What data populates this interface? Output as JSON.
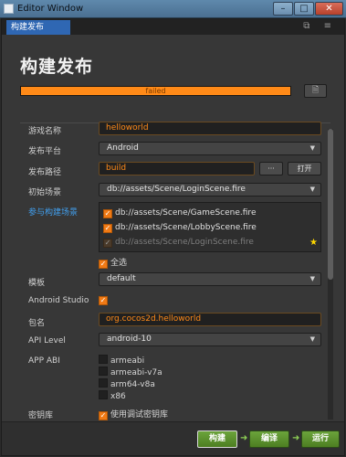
{
  "window": {
    "title": "Editor Window",
    "minimize": "–",
    "maximize": "□",
    "close": "✕"
  },
  "tab": {
    "label": "构建发布",
    "icons": "⧉ ≡"
  },
  "heading": "构建发布",
  "progress": {
    "status_text": "failed",
    "value": 1.0,
    "color": "#ff8a18"
  },
  "doc_button_icon": "document-icon",
  "form": {
    "game_name": {
      "label": "游戏名称",
      "value": "helloworld"
    },
    "platform": {
      "label": "发布平台",
      "value": "Android"
    },
    "build_path": {
      "label": "发布路径",
      "value": "build",
      "browse_label": "···",
      "open_label": "打开"
    },
    "start_scene": {
      "label": "初始场景",
      "value": "db://assets/Scene/LoginScene.fire"
    },
    "scenes": {
      "label": "参与构建场景",
      "items": [
        {
          "path": "db://assets/Scene/GameScene.fire",
          "checked": true
        },
        {
          "path": "db://assets/Scene/LobbyScene.fire",
          "checked": true
        },
        {
          "path": "db://assets/Scene/LoginScene.fire",
          "checked": true
        }
      ],
      "select_all_label": "全选"
    },
    "template": {
      "label": "模板",
      "value": "default"
    },
    "android_studio": {
      "label": "Android Studio",
      "checked": true
    },
    "package_name": {
      "label": "包名",
      "value": "org.cocos2d.helloworld"
    },
    "api_level": {
      "label": "API Level",
      "value": "android-10"
    },
    "app_abi": {
      "label": "APP ABI",
      "options": [
        "armeabi",
        "armeabi-v7a",
        "arm64-v8a",
        "x86"
      ]
    },
    "keystore": {
      "label": "密钥库",
      "option_label": "使用调试密钥库"
    }
  },
  "footer": {
    "build_label": "构建",
    "compile_label": "编译",
    "run_label": "运行"
  },
  "colors": {
    "accent": "#ff8a18",
    "tab": "#2f67b3",
    "link": "#41a0f0",
    "action": "#5a9230"
  }
}
